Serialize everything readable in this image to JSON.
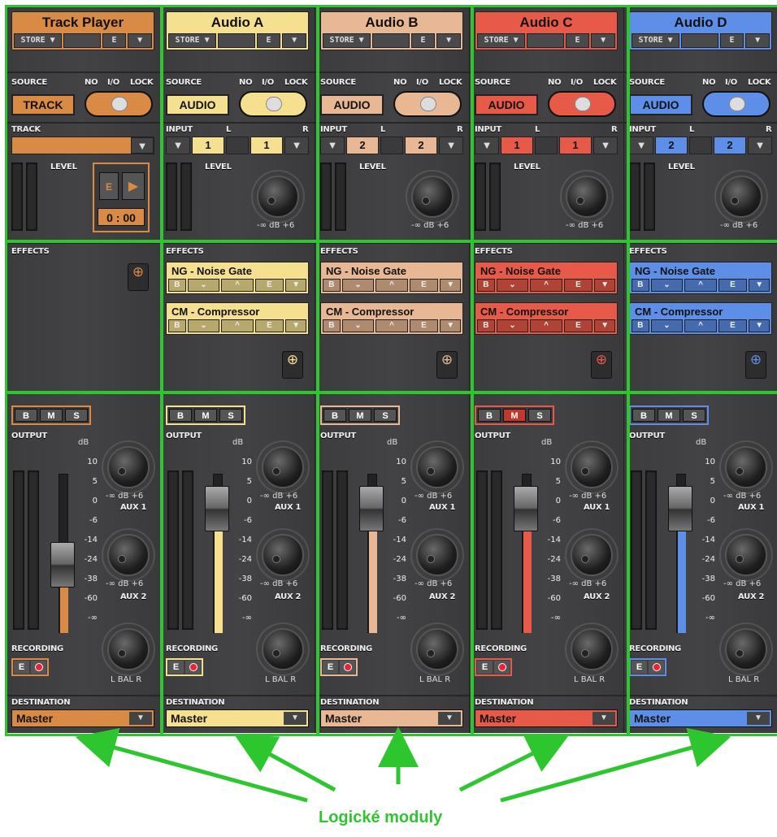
{
  "labels": {
    "store": "STORE ▼",
    "e": "E",
    "dropdown": "▼",
    "source": "SOURCE",
    "no": "NO",
    "io": "I/O",
    "lock": "LOCK",
    "track": "TRACK",
    "input": "INPUT",
    "l": "L",
    "r": "R",
    "level": "LEVEL",
    "db_range": "-∞ dB +6",
    "effects": "EFFECTS",
    "output": "OUTPUT",
    "db": "dB",
    "aux1": "AUX 1",
    "aux2": "AUX 2",
    "recording": "RECORDING",
    "bal": "L  BAL  R",
    "destination": "DESTINATION",
    "b": "B",
    "m": "M",
    "s": "S",
    "play": "▶",
    "down": "⌄",
    "up": "^"
  },
  "scale": [
    "10",
    "5",
    "0",
    "-6",
    "-14",
    "-24",
    "-38",
    "-60",
    "-∞"
  ],
  "caption": "Logické moduly",
  "strips": [
    {
      "name": "Track Player",
      "color": "#d98a45",
      "source": "TRACK",
      "time": "0 : 00",
      "destination": "Master",
      "fader_level": 0.43
    },
    {
      "name": "Audio A",
      "color": "#f5e08f",
      "source": "AUDIO",
      "input_l": "1",
      "input_r": "1",
      "effects": [
        "NG - Noise Gate",
        "CM - Compressor"
      ],
      "destination": "Master",
      "fader_level": 0.78
    },
    {
      "name": "Audio B",
      "color": "#e8b894",
      "source": "AUDIO",
      "input_l": "2",
      "input_r": "2",
      "effects": [
        "NG - Noise Gate",
        "CM - Compressor"
      ],
      "destination": "Master",
      "fader_level": 0.78
    },
    {
      "name": "Audio C",
      "color": "#e85a48",
      "source": "AUDIO",
      "input_l": "1",
      "input_r": "1",
      "effects": [
        "NG - Noise Gate",
        "CM - Compressor"
      ],
      "destination": "Master",
      "fader_level": 0.78
    },
    {
      "name": "Audio D",
      "color": "#5d8fe8",
      "source": "AUDIO",
      "input_l": "2",
      "input_r": "2",
      "effects": [
        "NG - Noise Gate",
        "CM - Compressor"
      ],
      "destination": "Master",
      "fader_level": 0.78
    }
  ]
}
